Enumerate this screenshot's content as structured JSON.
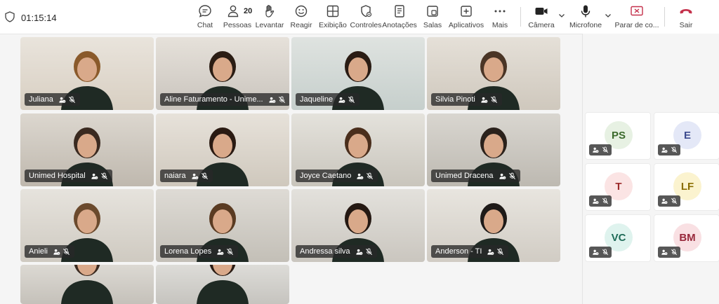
{
  "header": {
    "timer": "01:15:14",
    "participants_count": "20",
    "buttons": {
      "chat": "Chat",
      "people": "Pessoas",
      "raise": "Levantar",
      "react": "Reagir",
      "view": "Exibição",
      "controls": "Controles",
      "notes": "Anotações",
      "rooms": "Salas",
      "apps": "Aplicativos",
      "more": "Mais",
      "camera": "Câmera",
      "mic": "Microfone",
      "share": "Parar de co...",
      "leave": "Sair"
    },
    "colors": {
      "share_icon": "#c4314b",
      "leave_icon": "#c4314b"
    }
  },
  "tiles": [
    {
      "name": "Juliana"
    },
    {
      "name": "Aline Faturamento - Unime..."
    },
    {
      "name": "Jaqueline"
    },
    {
      "name": "Silvia Pinoti"
    },
    {
      "name": "Unimed Hospital"
    },
    {
      "name": "naiara"
    },
    {
      "name": "Joyce Caetano"
    },
    {
      "name": "Unimed Dracena"
    },
    {
      "name": "Anieli"
    },
    {
      "name": "Lorena Lopes"
    },
    {
      "name": "Andressa silva"
    },
    {
      "name": "Anderson - TI"
    },
    {
      "name": ""
    },
    {
      "name": ""
    }
  ],
  "roster": [
    {
      "initials": "PS",
      "bg": "#e7f1e3",
      "fg": "#3b6a2c"
    },
    {
      "initials": "E",
      "bg": "#e4e8f7",
      "fg": "#3d4b8f"
    },
    {
      "initials": "T",
      "bg": "#fbe4e4",
      "fg": "#9c2b2b"
    },
    {
      "initials": "LF",
      "bg": "#fbf3cf",
      "fg": "#8a6d00"
    },
    {
      "initials": "VC",
      "bg": "#dff3ee",
      "fg": "#1f6b58"
    },
    {
      "initials": "BM",
      "bg": "#f9e0e3",
      "fg": "#98283b"
    }
  ]
}
